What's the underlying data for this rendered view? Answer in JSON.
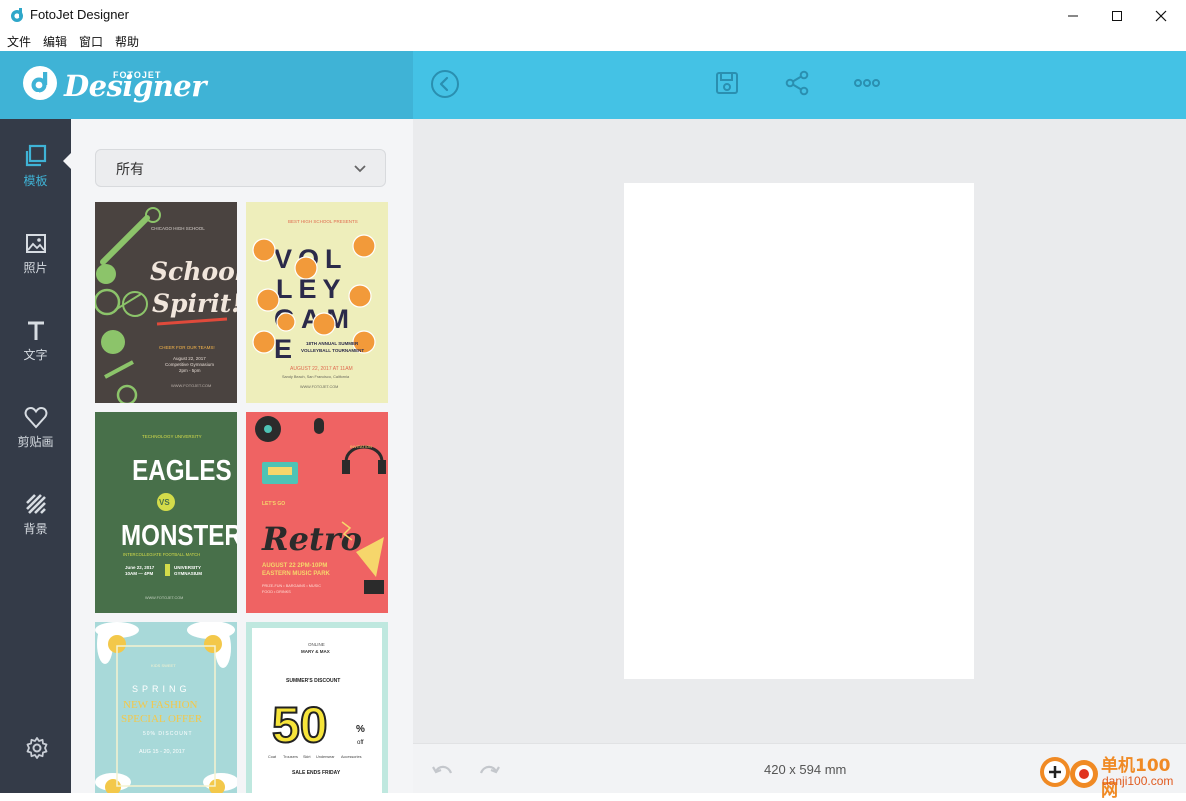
{
  "window": {
    "title": "FotoJet Designer",
    "controls": [
      "minimize",
      "maximize",
      "close"
    ]
  },
  "menubar": {
    "items": [
      "文件",
      "编辑",
      "窗口",
      "帮助"
    ]
  },
  "header": {
    "logo_small": "FOTOJET",
    "logo_big": "Designer",
    "icons": [
      "back-icon",
      "save-icon",
      "share-icon",
      "more-icon"
    ]
  },
  "sidebar": {
    "items": [
      {
        "label": "模板",
        "icon": "template-icon",
        "active": true
      },
      {
        "label": "照片",
        "icon": "photo-icon",
        "active": false
      },
      {
        "label": "文字",
        "icon": "text-icon",
        "active": false
      },
      {
        "label": "剪贴画",
        "icon": "clipart-icon",
        "active": false
      },
      {
        "label": "背景",
        "icon": "background-icon",
        "active": false
      }
    ],
    "settings_icon": "gear-icon"
  },
  "panel": {
    "category_selected": "所有",
    "templates": [
      {
        "name": "school-spirit",
        "lines": [
          "CHICAGO HIGH SCHOOL",
          "School",
          "Spirit!",
          "CHEER FOR OUR TEAMS!",
          "August 22, 2017",
          "Competitive Gymnasium",
          "2pm - 5pm",
          "WWW.FOTOJET.COM"
        ]
      },
      {
        "name": "volleyball",
        "lines": [
          "BEST HIGH SCHOOL PRESENTS",
          "VOL",
          "LEY",
          "GAM",
          "E",
          "18TH ANNUAL SUMMER",
          "VOLLEYBALL TOURNAMENT",
          "AUGUST 22, 2017 AT 11AM",
          "Sandy Beach, San Francisco, California",
          "WWW.FOTOJET.COM"
        ]
      },
      {
        "name": "eagles-vs-monster",
        "lines": [
          "TECHNOLOGY UNIVERSITY",
          "EAGLES",
          "VS",
          "MONSTER",
          "INTERCOLLEGIATE FOOTBALL MATCH",
          "June 22, 2017",
          "10AM — 4PM",
          "UNIVERSITY",
          "GYMNASIUM",
          "WWW.FOTOJET.COM"
        ]
      },
      {
        "name": "retro",
        "lines": [
          "INVITATION",
          "LET'S GO",
          "Retro",
          "AUGUST 22 2PM-10PM",
          "EASTERN MUSIC PARK",
          "PRIZE-FUN • BARGAINS • MUSIC",
          "FOOD • DRINKS"
        ]
      },
      {
        "name": "spring-fashion",
        "lines": [
          "KIDS SWEET",
          "SPRING",
          "NEW FASHION",
          "SPECIAL OFFER",
          "50% DISCOUNT",
          "AUG 15 - 20, 2017"
        ]
      },
      {
        "name": "summer-discount",
        "lines": [
          "ONLINE",
          "MARY & MAX",
          "SUMMER'S DISCOUNT",
          "50",
          "%",
          "off",
          "Coat",
          "Trousers",
          "Skirt",
          "Underwear",
          "Accessories",
          "SALE ENDS FRIDAY"
        ]
      }
    ]
  },
  "canvas": {
    "page_size": "420 x 594 mm"
  },
  "bottombar": {
    "icons": [
      "undo-icon",
      "redo-icon",
      "zoom-in-icon",
      "zoom-out-icon"
    ]
  },
  "watermark": {
    "cn": "单机100网",
    "url": "danji100.com"
  },
  "colors": {
    "header": "#44c2e5",
    "header_left": "#3fb3d6",
    "sidebar": "#343b48",
    "accent": "#3fb3d6",
    "panel": "#f4f5f7",
    "canvas_bg": "#eaebed"
  }
}
